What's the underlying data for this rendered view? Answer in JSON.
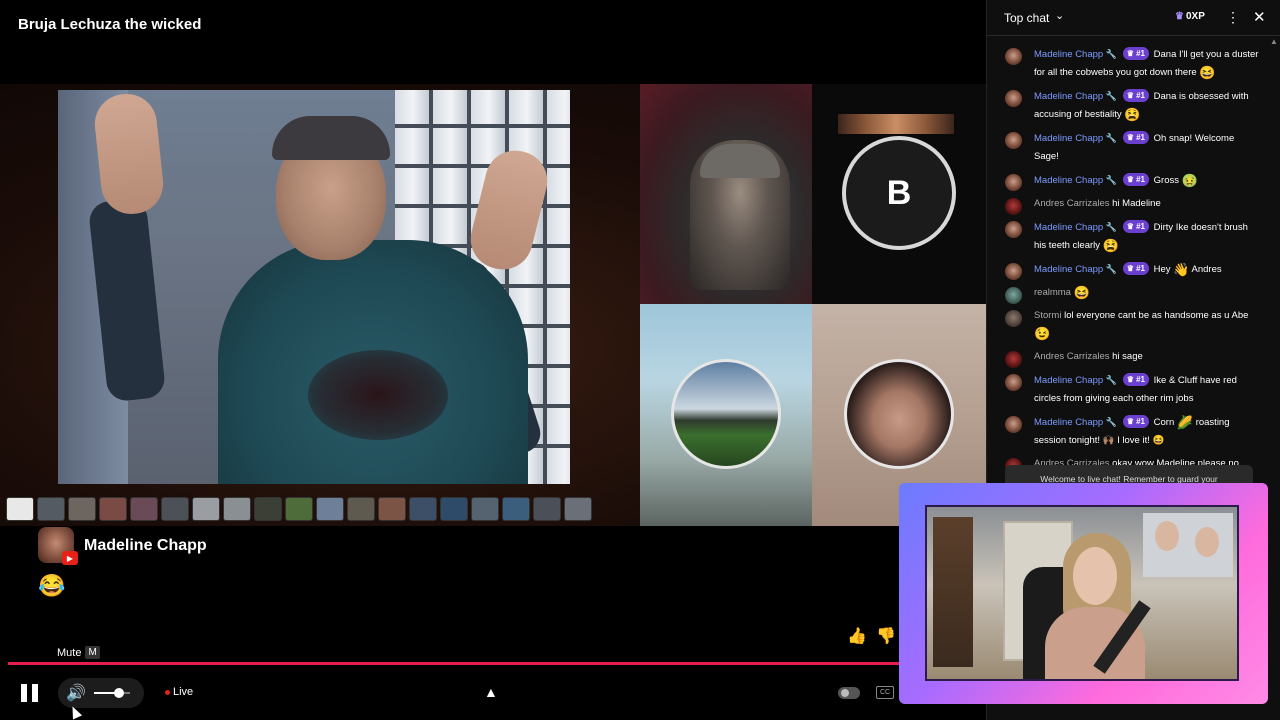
{
  "video": {
    "title": "Bruja Lechuza the wicked"
  },
  "guest_tiles": {
    "b_tile_letter": "B"
  },
  "reaction": {
    "name": "Madeline Chapp",
    "emoji": "😂"
  },
  "controls": {
    "mute_tooltip": "Mute",
    "mute_shortcut": "M",
    "live_label": "Live",
    "volume_level": 0.7,
    "cc_label": "CC",
    "like_icon": "👍",
    "dislike_icon": "👎"
  },
  "chat": {
    "header_title": "Top chat",
    "xp_label": "0XP",
    "welcome_text": "Welcome to live chat! Remember to guard your",
    "messages": [
      {
        "author": "Madeline Chapp",
        "rank": "#1",
        "text": "Dana I'll get you a duster for all the cobwebs you got down there",
        "emoji": "😆"
      },
      {
        "author": "Madeline Chapp",
        "rank": "#1",
        "text": "Dana is obsessed with accusing of bestiality",
        "emoji": "😫"
      },
      {
        "author": "Madeline Chapp",
        "rank": "#1",
        "text": "Oh snap! Welcome Sage!",
        "emoji": ""
      },
      {
        "author": "Madeline Chapp",
        "rank": "#1",
        "text": "Gross",
        "emoji": "🤢"
      },
      {
        "author": "Andres Carrizales",
        "rank": "",
        "text": "hi Madeline",
        "emoji": ""
      },
      {
        "author": "Madeline Chapp",
        "rank": "#1",
        "text": "Dirty Ike doesn't brush his teeth clearly",
        "emoji": "😫"
      },
      {
        "author": "Madeline Chapp",
        "rank": "#1",
        "text": "Hey",
        "emoji": "👋",
        "tail": "Andres"
      },
      {
        "author": "realmma",
        "rank": "",
        "text": "",
        "emoji": "😆"
      },
      {
        "author": "Stormi",
        "rank": "",
        "text": "lol everyone cant be as handsome as u Abe",
        "emoji": "😉"
      },
      {
        "author": "Andres Carrizales",
        "rank": "",
        "text": "hi sage",
        "emoji": ""
      },
      {
        "author": "Madeline Chapp",
        "rank": "#1",
        "text": "Ike & Cluff have red circles from giving each other rim jobs",
        "emoji": ""
      },
      {
        "author": "Madeline Chapp",
        "rank": "#1",
        "text": "Corn",
        "emoji": "🌽",
        "tail": "roasting session tonight! 🙌🏽 I love it! 😆"
      },
      {
        "author": "Andres Carrizales",
        "rank": "",
        "text": "okay wow Madeline please no details like that it's gross enough with the pics on",
        "emoji": ""
      }
    ]
  }
}
